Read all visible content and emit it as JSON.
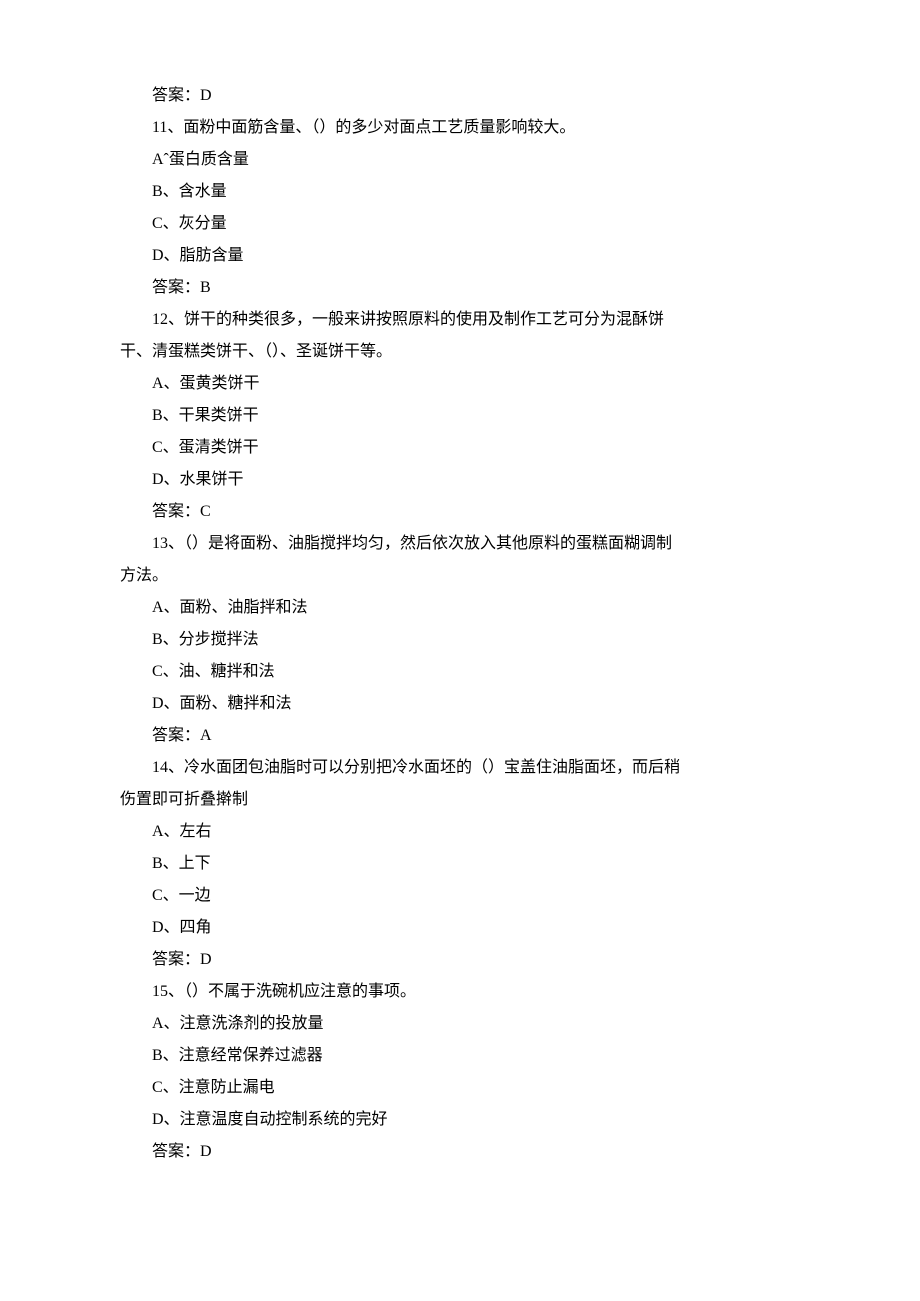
{
  "q10_answer_label": "答案：D",
  "q11": {
    "stem": "11、面粉中面筋含量、（）的多少对面点工艺质量影响较大。",
    "optA": "Aˆ蛋白质含量",
    "optB": "B、含水量",
    "optC": "C、灰分量",
    "optD": "D、脂肪含量",
    "answer": "答案：B"
  },
  "q12": {
    "stem1": "12、饼干的种类很多，一般来讲按照原料的使用及制作工艺可分为混酥饼",
    "stem2": "干、清蛋糕类饼干、（）、圣诞饼干等。",
    "optA": "A、蛋黄类饼干",
    "optB": "B、干果类饼干",
    "optC": "C、蛋清类饼干",
    "optD": "D、水果饼干",
    "answer": "答案：C"
  },
  "q13": {
    "stem1": "13、（）是将面粉、油脂搅拌均匀，然后依次放入其他原料的蛋糕面糊调制",
    "stem2": "方法。",
    "optA": "A、面粉、油脂拌和法",
    "optB": "B、分步搅拌法",
    "optC": "C、油、糖拌和法",
    "optD": "D、面粉、糖拌和法",
    "answer": "答案：A"
  },
  "q14": {
    "stem1": "14、冷水面团包油脂时可以分别把冷水面坯的（）宝盖住油脂面坯，而后稍",
    "stem2": "伤置即可折叠擀制",
    "optA": "A、左右",
    "optB": "B、上下",
    "optC": "C、一边",
    "optD": "D、四角",
    "answer": "答案：D"
  },
  "q15": {
    "stem": "15、（）不属于洗碗机应注意的事项。",
    "optA": "A、注意洗涤剂的投放量",
    "optB": "B、注意经常保养过滤器",
    "optC": "C、注意防止漏电",
    "optD": "D、注意温度自动控制系统的完好",
    "answer": "答案：D"
  }
}
